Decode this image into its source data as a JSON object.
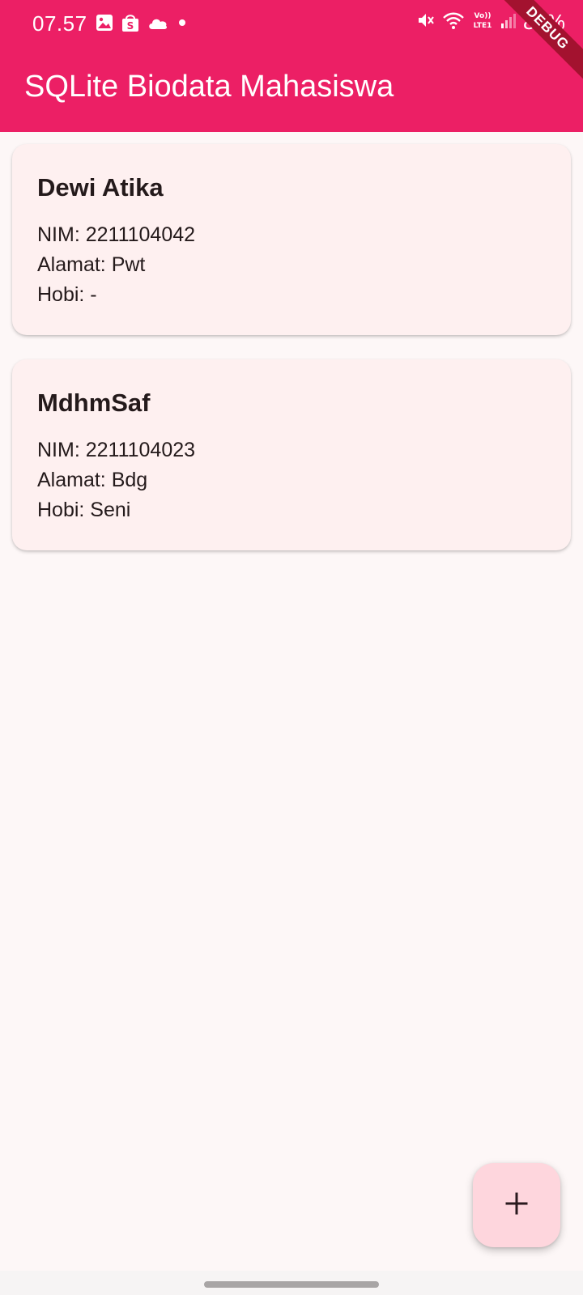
{
  "status_bar": {
    "time": "07.57",
    "battery": "85%",
    "left_icons": [
      "image-icon",
      "shopee-icon",
      "cloud-icon",
      "dot-icon"
    ],
    "right_icons": [
      "mute-icon",
      "wifi-icon",
      "volte-icon",
      "signal-icon"
    ]
  },
  "debug_banner": "DEBUG",
  "app_bar": {
    "title": "SQLite Biodata Mahasiswa"
  },
  "students": [
    {
      "name": "Dewi Atika",
      "nim": "NIM: 2211104042",
      "alamat": "Alamat: Pwt",
      "hobi": "Hobi: -"
    },
    {
      "name": "MdhmSaf",
      "nim": "NIM: 2211104023",
      "alamat": "Alamat: Bdg",
      "hobi": "Hobi: Seni"
    }
  ],
  "fab": {
    "icon": "plus-icon",
    "label": "+"
  },
  "colors": {
    "primary": "#EC1F65",
    "background": "#FDF7F7",
    "card": "#FEF0F0",
    "fab": "#FED6DD",
    "text": "#241A1B"
  }
}
